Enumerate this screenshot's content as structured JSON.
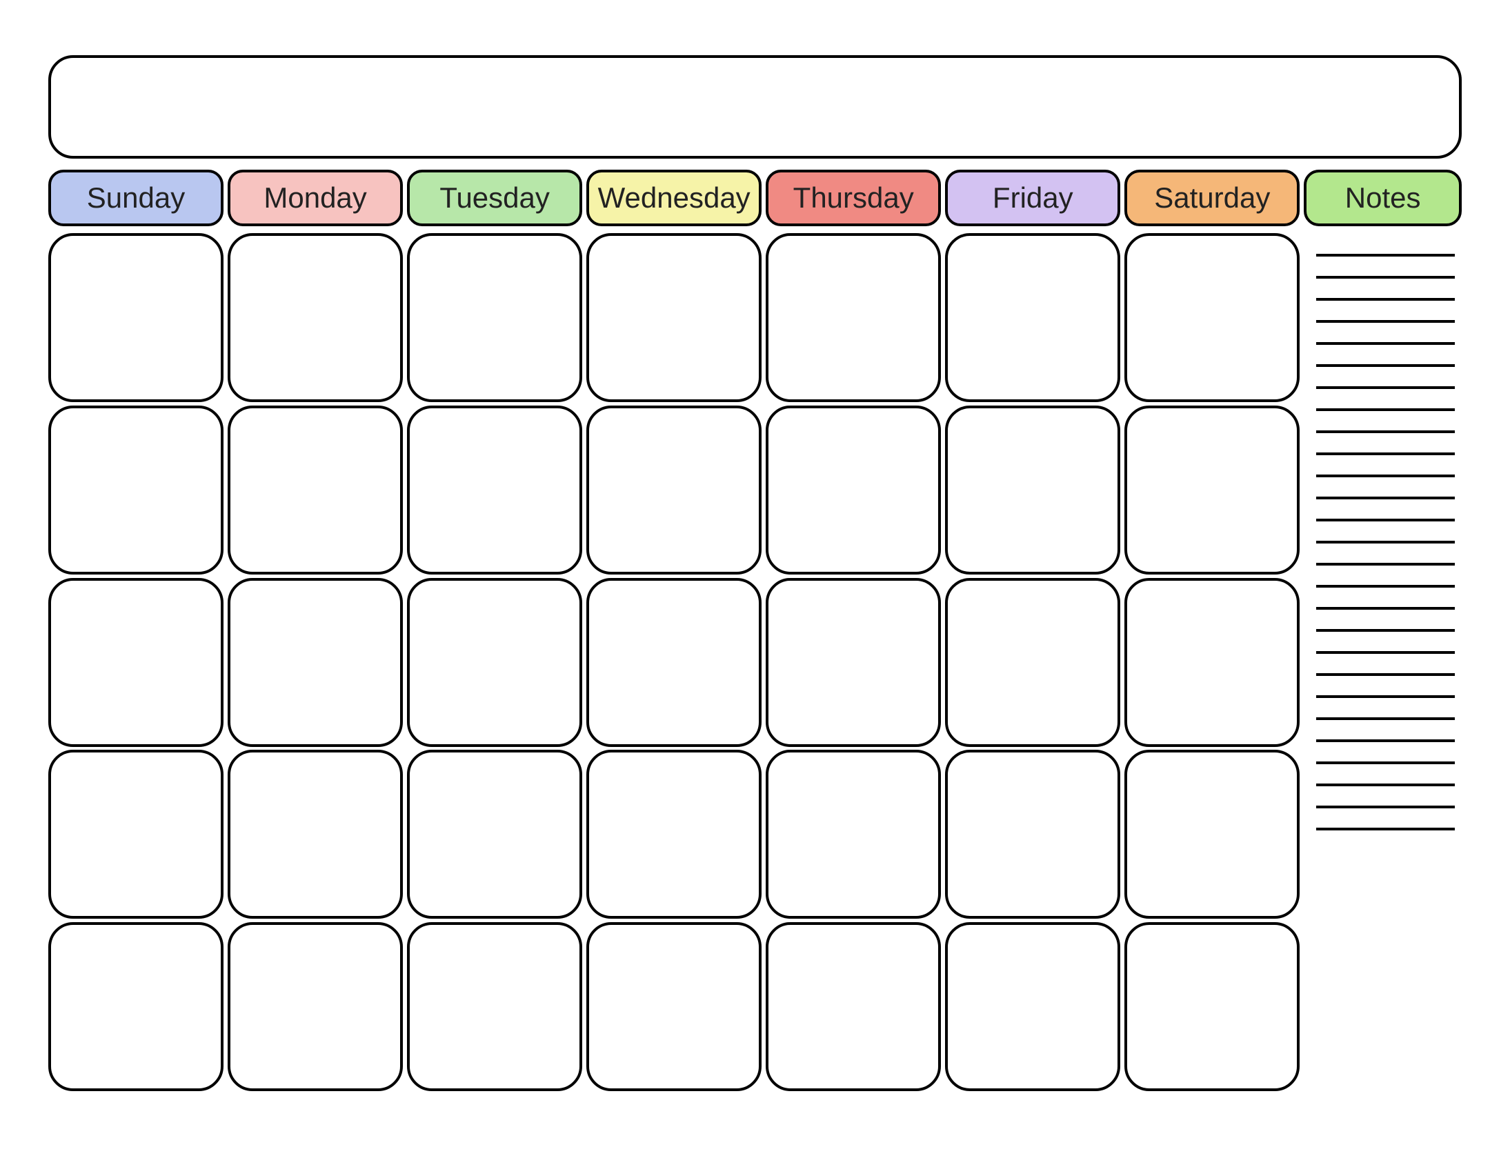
{
  "title": "",
  "columns": [
    {
      "label": "Sunday",
      "color": "#b9c7f0"
    },
    {
      "label": "Monday",
      "color": "#f7c3c0"
    },
    {
      "label": "Tuesday",
      "color": "#b7e7a9"
    },
    {
      "label": "Wednesday",
      "color": "#f6f3a8"
    },
    {
      "label": "Thursday",
      "color": "#f08a83"
    },
    {
      "label": "Friday",
      "color": "#d3c2f2"
    },
    {
      "label": "Saturday",
      "color": "#f5b778"
    }
  ],
  "notes": {
    "label": "Notes",
    "color": "#b3e78d",
    "line_count": 27
  },
  "weeks": 5,
  "days_per_week": 7
}
